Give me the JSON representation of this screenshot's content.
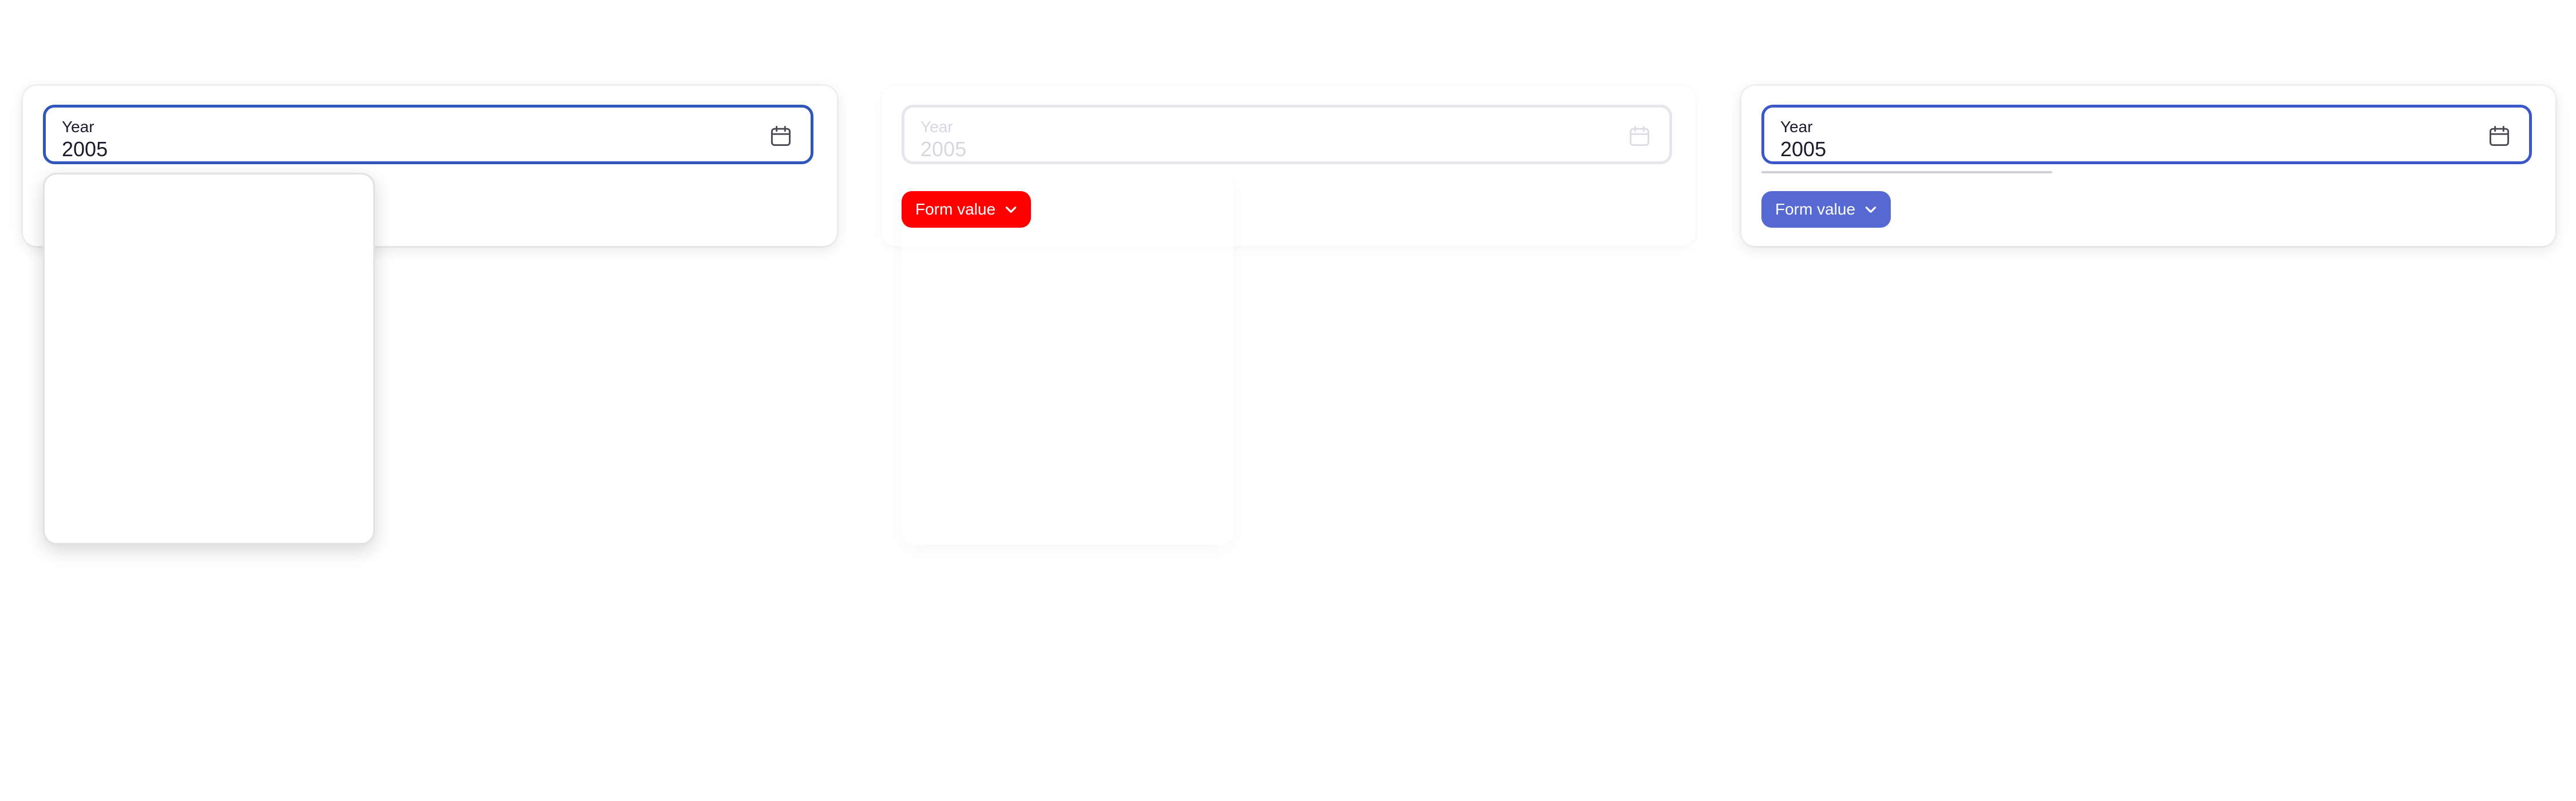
{
  "panels": [
    {
      "field": {
        "label": "Year",
        "value": "2005",
        "icon": "calendar-icon"
      },
      "state": "open",
      "accent": "#2f56b8"
    },
    {
      "field": {
        "label": "Year",
        "value": "2005",
        "icon": "calendar-icon"
      },
      "state": "disabled",
      "chip": {
        "label": "Form value",
        "icon": "chevron-down-icon",
        "color": "#ff0000"
      }
    },
    {
      "field": {
        "label": "Year",
        "value": "2005",
        "icon": "calendar-icon"
      },
      "state": "focused",
      "accent": "#3c57c8",
      "chip": {
        "label": "Form value",
        "icon": "chevron-down-icon",
        "color": "#5669d2"
      }
    }
  ]
}
